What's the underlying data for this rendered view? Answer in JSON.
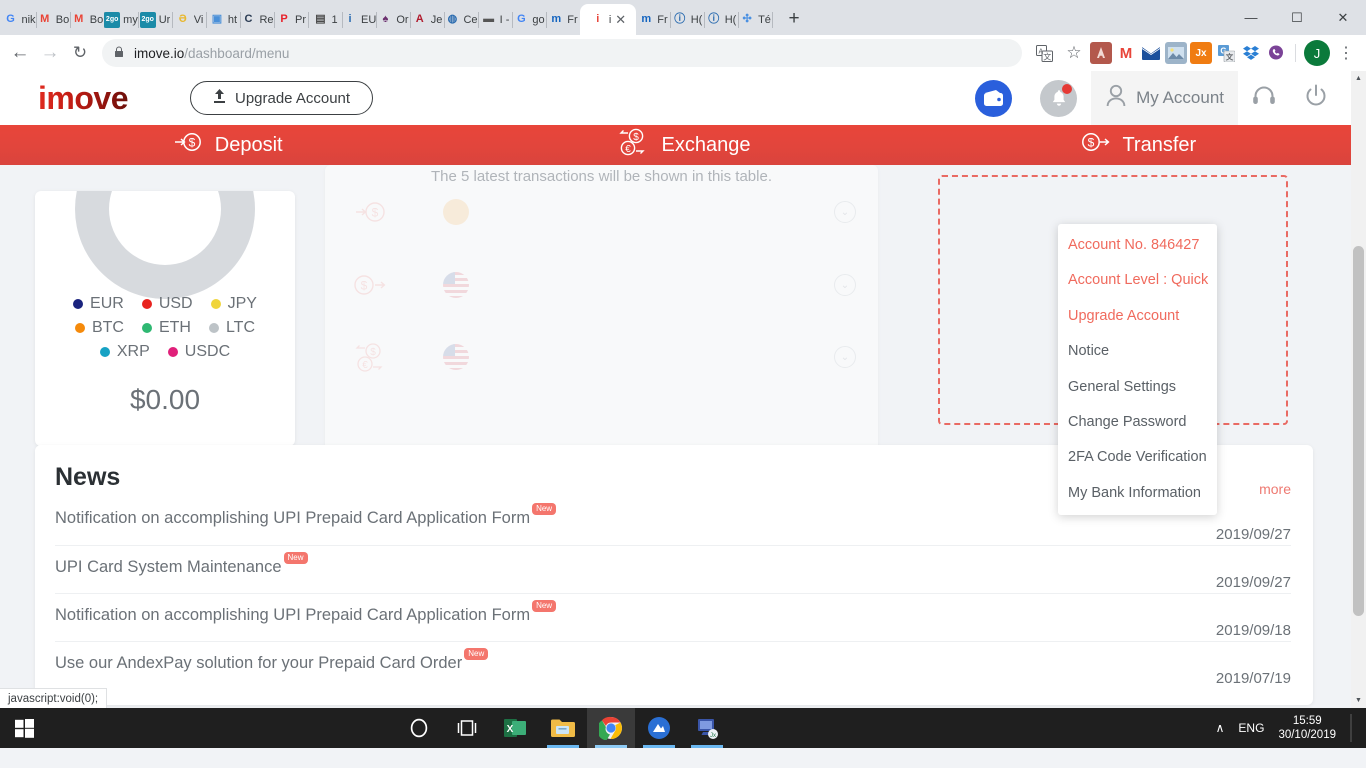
{
  "browser": {
    "tabs": [
      {
        "favicon": "google-icon",
        "title": "nik",
        "color": "#4285f4",
        "glyph": "G"
      },
      {
        "favicon": "gmail-icon",
        "title": "Bo",
        "color": "#ea4335",
        "glyph": "M"
      },
      {
        "favicon": "gmail-icon",
        "title": "Bo",
        "color": "#ea4335",
        "glyph": "M"
      },
      {
        "favicon": "2go-icon",
        "title": "my",
        "color": "#1b8ba8",
        "glyph": "2go"
      },
      {
        "favicon": "2go-icon",
        "title": "Ur",
        "color": "#1b8ba8",
        "glyph": "2go"
      },
      {
        "favicon": "vimeo-icon",
        "title": "Vi",
        "color": "#e8b830",
        "glyph": "Ə"
      },
      {
        "favicon": "html-icon",
        "title": "ht",
        "color": "#4a90d9",
        "glyph": "▣"
      },
      {
        "favicon": "cube-icon",
        "title": "Re",
        "color": "#2b3c54",
        "glyph": "C"
      },
      {
        "favicon": "p-icon",
        "title": "Pr",
        "color": "#e8212a",
        "glyph": "P"
      },
      {
        "favicon": "keyboard-icon",
        "title": "1",
        "color": "#4a4a4a",
        "glyph": "▤"
      },
      {
        "favicon": "info-icon",
        "title": "EU",
        "color": "#2b6cb0",
        "glyph": "i"
      },
      {
        "favicon": "ink-icon",
        "title": "Or",
        "color": "#6b2f6e",
        "glyph": "♠"
      },
      {
        "favicon": "a-icon",
        "title": "Je",
        "color": "#b01c2e",
        "glyph": "A"
      },
      {
        "favicon": "globe-icon",
        "title": "Ce",
        "color": "#2b6cb0",
        "glyph": "◍"
      },
      {
        "favicon": "bar-icon",
        "title": "I -",
        "color": "#555555",
        "glyph": "▬"
      },
      {
        "favicon": "google-icon",
        "title": "go",
        "color": "#4285f4",
        "glyph": "G"
      },
      {
        "favicon": "m-icon",
        "title": "Fr",
        "color": "#1565c0",
        "glyph": "m"
      },
      {
        "favicon": "imove-icon",
        "title": "i",
        "color": "#e8453a",
        "glyph": "i",
        "active": true,
        "close": "✕"
      },
      {
        "favicon": "m-icon",
        "title": "Fr",
        "color": "#1565c0",
        "glyph": "m"
      },
      {
        "favicon": "i-circle-icon",
        "title": "H(",
        "color": "#2b6cb0",
        "glyph": "ⓘ"
      },
      {
        "favicon": "i-circle-icon",
        "title": "H(",
        "color": "#2b6cb0",
        "glyph": "ⓘ"
      },
      {
        "favicon": "dropbox-icon",
        "title": "Té",
        "color": "#4a90e2",
        "glyph": "✣"
      }
    ],
    "newtab_label": "+",
    "window_controls": {
      "minimize": "—",
      "maximize": "☐",
      "close": "✕"
    },
    "nav": {
      "back": "←",
      "forward": "→",
      "reload": "↻"
    },
    "omnibox": {
      "lock": "🔒",
      "url_domain": "imove.io",
      "url_path": "/dashboard/menu"
    },
    "toolbar_icons": [
      {
        "name": "translate-icon",
        "glyph": "文",
        "color": "#5f6368"
      },
      {
        "name": "bookmark-star-icon",
        "glyph": "☆",
        "color": "#5f6368"
      }
    ],
    "extensions": [
      {
        "name": "adobe-acrobat-extension",
        "glyph": "✈",
        "color": "#b3584c"
      },
      {
        "name": "gmail-extension",
        "glyph": "M",
        "color": "#e8453a"
      },
      {
        "name": "mail-extension",
        "glyph": "✉",
        "color": "#1a4f9c"
      },
      {
        "name": "image-extension",
        "glyph": "⛰",
        "color": "#7d98b8"
      },
      {
        "name": "jx-extension",
        "glyph": "Jx",
        "color": "#f07c12"
      },
      {
        "name": "google-translate-extension",
        "glyph": "G",
        "color": "#5b9bd5"
      },
      {
        "name": "dropbox-extension",
        "glyph": "❖",
        "color": "#2a7fd4"
      },
      {
        "name": "viber-extension",
        "glyph": "☎",
        "color": "#7b4397"
      }
    ],
    "profile_initial": "J",
    "menu_glyph": "⋮"
  },
  "site": {
    "logo": "imove",
    "upgrade_button": "Upgrade Account",
    "upgrade_icon": "⬆",
    "header_right": {
      "wallet_icon": "wallet-icon",
      "bell_icon": "bell-icon",
      "account_label": "My Account",
      "person_icon": "person-icon",
      "support_icon": "headset-icon",
      "power_icon": "power-icon"
    },
    "nav_items": [
      {
        "icon": "deposit-icon",
        "label": "Deposit"
      },
      {
        "icon": "exchange-icon",
        "label": "Exchange"
      },
      {
        "icon": "transfer-icon",
        "label": "Transfer"
      }
    ]
  },
  "balance_card": {
    "amount": "$0.00",
    "legend": [
      {
        "label": "EUR",
        "color": "#1a237e"
      },
      {
        "label": "USD",
        "color": "#e8231f"
      },
      {
        "label": "JPY",
        "color": "#f0d53c"
      },
      {
        "label": "BTC",
        "color": "#f58a0b"
      },
      {
        "label": "ETH",
        "color": "#2eb872"
      },
      {
        "label": "LTC",
        "color": "#bdc3c7"
      },
      {
        "label": "XRP",
        "color": "#17a2c4"
      },
      {
        "label": "USDC",
        "color": "#e0207a"
      }
    ]
  },
  "transactions_card": {
    "note": "The 5 latest transactions will be shown in this table.",
    "rows": [
      {
        "type_icon": "deposit-icon",
        "flag": "btc",
        "chevron": "⌄"
      },
      {
        "type_icon": "transfer-icon",
        "flag": "us",
        "chevron": "⌄"
      },
      {
        "type_icon": "exchange-icon",
        "flag": "us",
        "chevron": "⌄"
      }
    ]
  },
  "news": {
    "title": "News",
    "more_label": "more",
    "badge_label": "New",
    "items": [
      {
        "text": "Notification on accomplishing UPI Prepaid Card Application Form",
        "date": "2019/09/27",
        "new": true
      },
      {
        "text": "UPI Card System Maintenance",
        "date": "2019/09/27",
        "new": true
      },
      {
        "text": "Notification on accomplishing UPI Prepaid Card Application Form",
        "date": "2019/09/18",
        "new": true
      },
      {
        "text": "Use our AndexPay solution for your Prepaid Card Order",
        "date": "2019/07/19",
        "new": true
      }
    ]
  },
  "account_dropdown": {
    "items": [
      {
        "label": "Account No. 846427",
        "accent": true
      },
      {
        "label": "Account Level : Quick",
        "accent": true
      },
      {
        "label": "Upgrade Account",
        "accent": true
      },
      {
        "label": "Notice",
        "accent": false
      },
      {
        "label": "General Settings",
        "accent": false
      },
      {
        "label": "Change Password",
        "accent": false
      },
      {
        "label": "2FA Code Verification",
        "accent": false
      },
      {
        "label": "My Bank Information",
        "accent": false
      }
    ]
  },
  "status_bar": {
    "text": "javascript:void(0);"
  },
  "taskbar": {
    "start_icon": "windows-start-icon",
    "apps": [
      {
        "name": "cortana-icon",
        "glyph": "◯",
        "color": "#ffffff"
      },
      {
        "name": "task-view-icon",
        "glyph": "⌸",
        "color": "#ffffff"
      },
      {
        "name": "excel-icon",
        "glyph": "X",
        "color": "#1d7044"
      },
      {
        "name": "file-explorer-icon",
        "glyph": "📁",
        "color": "#e8b63a"
      },
      {
        "name": "chrome-icon",
        "glyph": "◉",
        "color": "#4285f4"
      },
      {
        "name": "nord-vpn-icon",
        "glyph": "▲",
        "color": "#2a6fd4"
      },
      {
        "name": "remote-desktop-icon",
        "glyph": "🖥",
        "color": "#3a55a8"
      }
    ],
    "tray": {
      "chevron": "∧",
      "language": "ENG",
      "time": "15:59",
      "date": "30/10/2019"
    }
  },
  "colors": {
    "brand_red": "#e8453a",
    "accent_coral": "#f06a5d",
    "chrome_bg": "#dee1e6",
    "page_bg": "#f1f3f6"
  }
}
